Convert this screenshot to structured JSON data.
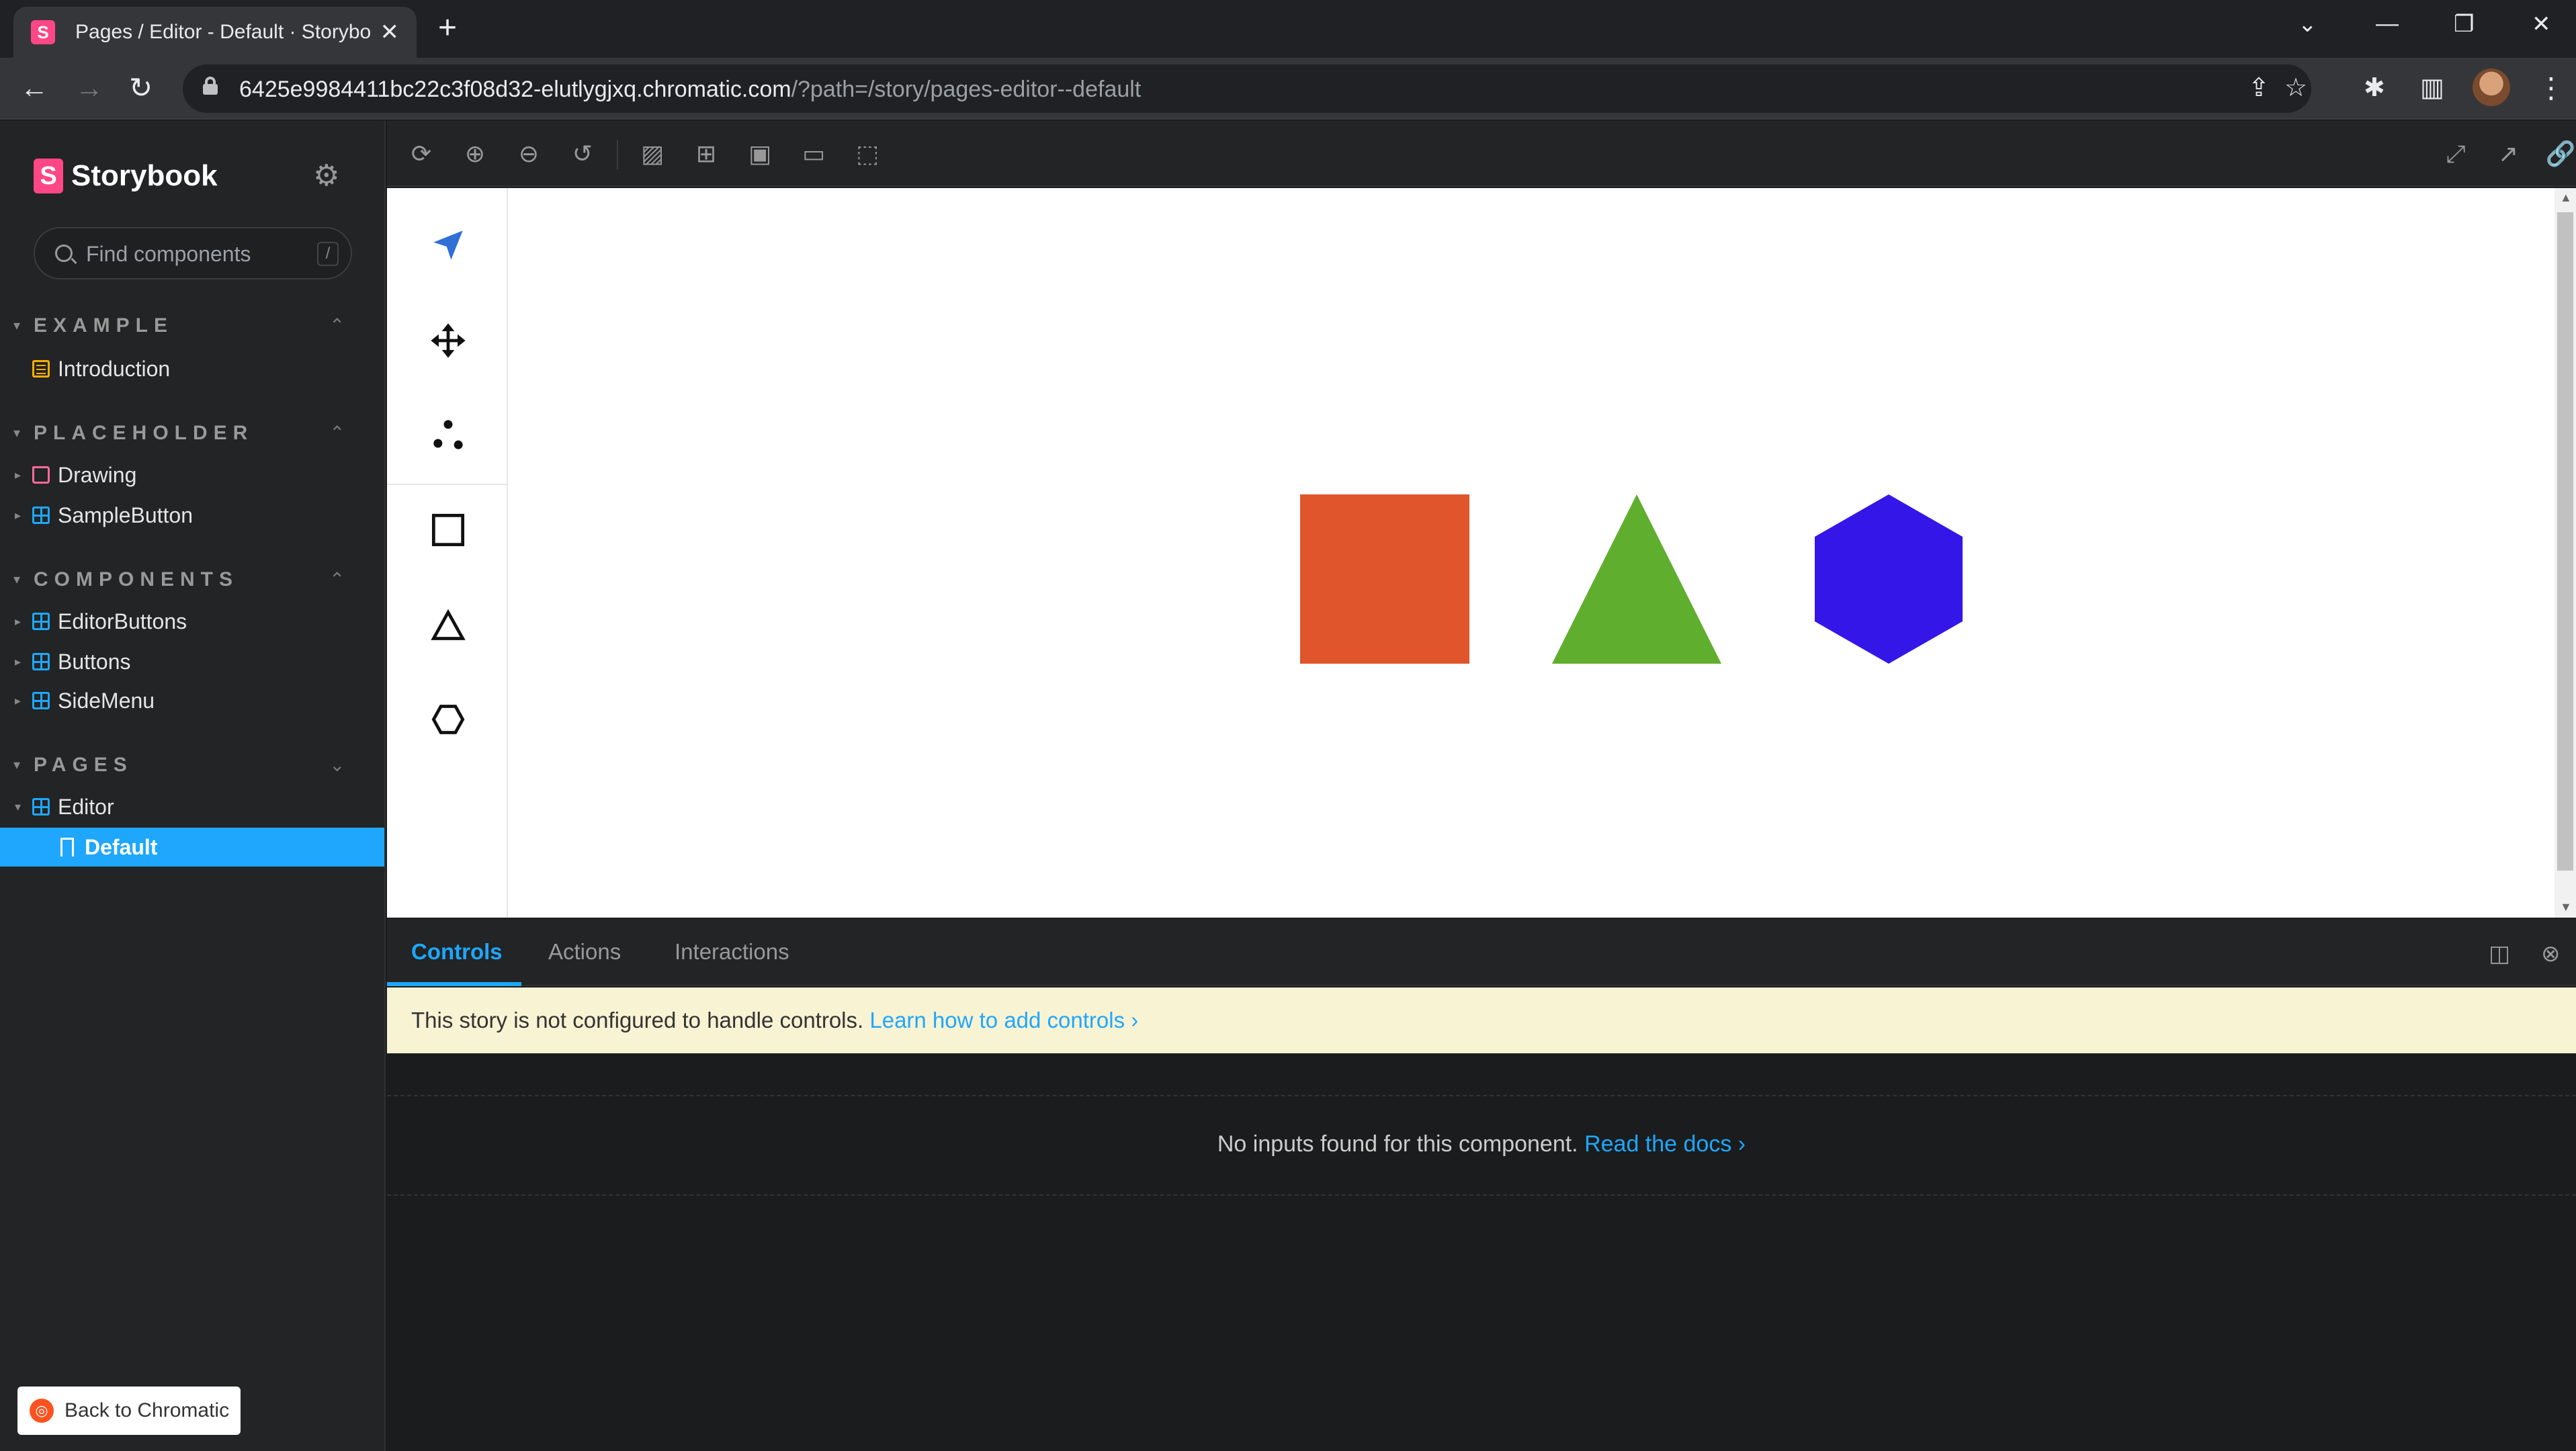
{
  "browser": {
    "tab_title": "Pages / Editor - Default · Storybook",
    "tab_favicon": "S",
    "url_host": "6425e9984411bc22c3f08d32-elutlygjxq.chromatic.com",
    "url_path": "/?path=/story/pages-editor--default"
  },
  "sidebar": {
    "brand": "Storybook",
    "logo_letter": "S",
    "search_placeholder": "Find components",
    "search_shortcut": "/",
    "sections": [
      {
        "label": "EXAMPLE",
        "items": [
          {
            "label": "Introduction",
            "icon": "doc-icon"
          }
        ]
      },
      {
        "label": "PLACEHOLDER",
        "items": [
          {
            "label": "Drawing",
            "icon": "folder-icon"
          },
          {
            "label": "SampleButton",
            "icon": "component-icon"
          }
        ]
      },
      {
        "label": "COMPONENTS",
        "items": [
          {
            "label": "EditorButtons",
            "icon": "component-icon"
          },
          {
            "label": "Buttons",
            "icon": "component-icon"
          },
          {
            "label": "SideMenu",
            "icon": "component-icon"
          }
        ]
      },
      {
        "label": "PAGES",
        "items": [
          {
            "label": "Editor",
            "icon": "component-icon"
          },
          {
            "label": "Default",
            "icon": "bookmark-icon",
            "selected": true
          }
        ]
      }
    ],
    "back_button": "Back to Chromatic"
  },
  "addons": {
    "tabs": [
      "Controls",
      "Actions",
      "Interactions"
    ],
    "active_tab": "Controls",
    "notice_text": "This story is not configured to handle controls.",
    "notice_link": "Learn how to add controls",
    "empty_text": "No inputs found for this component.",
    "empty_link": "Read the docs"
  },
  "colors": {
    "accent": "#1ea7fd",
    "square": "#e0552b",
    "triangle": "#5fae2e",
    "hexagon": "#3416e8",
    "select_tool": "#2f6fd6"
  }
}
